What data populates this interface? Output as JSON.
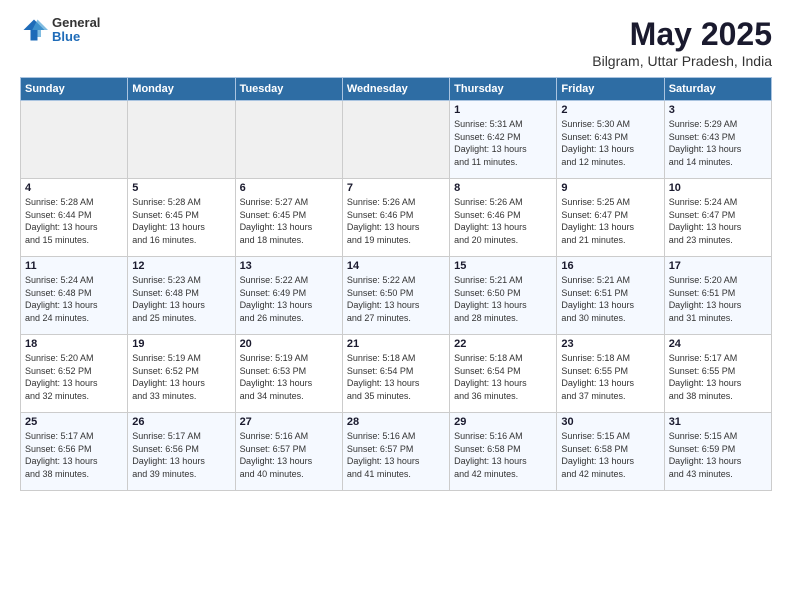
{
  "header": {
    "logo_general": "General",
    "logo_blue": "Blue",
    "title": "May 2025",
    "subtitle": "Bilgram, Uttar Pradesh, India"
  },
  "weekdays": [
    "Sunday",
    "Monday",
    "Tuesday",
    "Wednesday",
    "Thursday",
    "Friday",
    "Saturday"
  ],
  "weeks": [
    [
      {
        "day": "",
        "info": ""
      },
      {
        "day": "",
        "info": ""
      },
      {
        "day": "",
        "info": ""
      },
      {
        "day": "",
        "info": ""
      },
      {
        "day": "1",
        "info": "Sunrise: 5:31 AM\nSunset: 6:42 PM\nDaylight: 13 hours\nand 11 minutes."
      },
      {
        "day": "2",
        "info": "Sunrise: 5:30 AM\nSunset: 6:43 PM\nDaylight: 13 hours\nand 12 minutes."
      },
      {
        "day": "3",
        "info": "Sunrise: 5:29 AM\nSunset: 6:43 PM\nDaylight: 13 hours\nand 14 minutes."
      }
    ],
    [
      {
        "day": "4",
        "info": "Sunrise: 5:28 AM\nSunset: 6:44 PM\nDaylight: 13 hours\nand 15 minutes."
      },
      {
        "day": "5",
        "info": "Sunrise: 5:28 AM\nSunset: 6:45 PM\nDaylight: 13 hours\nand 16 minutes."
      },
      {
        "day": "6",
        "info": "Sunrise: 5:27 AM\nSunset: 6:45 PM\nDaylight: 13 hours\nand 18 minutes."
      },
      {
        "day": "7",
        "info": "Sunrise: 5:26 AM\nSunset: 6:46 PM\nDaylight: 13 hours\nand 19 minutes."
      },
      {
        "day": "8",
        "info": "Sunrise: 5:26 AM\nSunset: 6:46 PM\nDaylight: 13 hours\nand 20 minutes."
      },
      {
        "day": "9",
        "info": "Sunrise: 5:25 AM\nSunset: 6:47 PM\nDaylight: 13 hours\nand 21 minutes."
      },
      {
        "day": "10",
        "info": "Sunrise: 5:24 AM\nSunset: 6:47 PM\nDaylight: 13 hours\nand 23 minutes."
      }
    ],
    [
      {
        "day": "11",
        "info": "Sunrise: 5:24 AM\nSunset: 6:48 PM\nDaylight: 13 hours\nand 24 minutes."
      },
      {
        "day": "12",
        "info": "Sunrise: 5:23 AM\nSunset: 6:48 PM\nDaylight: 13 hours\nand 25 minutes."
      },
      {
        "day": "13",
        "info": "Sunrise: 5:22 AM\nSunset: 6:49 PM\nDaylight: 13 hours\nand 26 minutes."
      },
      {
        "day": "14",
        "info": "Sunrise: 5:22 AM\nSunset: 6:50 PM\nDaylight: 13 hours\nand 27 minutes."
      },
      {
        "day": "15",
        "info": "Sunrise: 5:21 AM\nSunset: 6:50 PM\nDaylight: 13 hours\nand 28 minutes."
      },
      {
        "day": "16",
        "info": "Sunrise: 5:21 AM\nSunset: 6:51 PM\nDaylight: 13 hours\nand 30 minutes."
      },
      {
        "day": "17",
        "info": "Sunrise: 5:20 AM\nSunset: 6:51 PM\nDaylight: 13 hours\nand 31 minutes."
      }
    ],
    [
      {
        "day": "18",
        "info": "Sunrise: 5:20 AM\nSunset: 6:52 PM\nDaylight: 13 hours\nand 32 minutes."
      },
      {
        "day": "19",
        "info": "Sunrise: 5:19 AM\nSunset: 6:52 PM\nDaylight: 13 hours\nand 33 minutes."
      },
      {
        "day": "20",
        "info": "Sunrise: 5:19 AM\nSunset: 6:53 PM\nDaylight: 13 hours\nand 34 minutes."
      },
      {
        "day": "21",
        "info": "Sunrise: 5:18 AM\nSunset: 6:54 PM\nDaylight: 13 hours\nand 35 minutes."
      },
      {
        "day": "22",
        "info": "Sunrise: 5:18 AM\nSunset: 6:54 PM\nDaylight: 13 hours\nand 36 minutes."
      },
      {
        "day": "23",
        "info": "Sunrise: 5:18 AM\nSunset: 6:55 PM\nDaylight: 13 hours\nand 37 minutes."
      },
      {
        "day": "24",
        "info": "Sunrise: 5:17 AM\nSunset: 6:55 PM\nDaylight: 13 hours\nand 38 minutes."
      }
    ],
    [
      {
        "day": "25",
        "info": "Sunrise: 5:17 AM\nSunset: 6:56 PM\nDaylight: 13 hours\nand 38 minutes."
      },
      {
        "day": "26",
        "info": "Sunrise: 5:17 AM\nSunset: 6:56 PM\nDaylight: 13 hours\nand 39 minutes."
      },
      {
        "day": "27",
        "info": "Sunrise: 5:16 AM\nSunset: 6:57 PM\nDaylight: 13 hours\nand 40 minutes."
      },
      {
        "day": "28",
        "info": "Sunrise: 5:16 AM\nSunset: 6:57 PM\nDaylight: 13 hours\nand 41 minutes."
      },
      {
        "day": "29",
        "info": "Sunrise: 5:16 AM\nSunset: 6:58 PM\nDaylight: 13 hours\nand 42 minutes."
      },
      {
        "day": "30",
        "info": "Sunrise: 5:15 AM\nSunset: 6:58 PM\nDaylight: 13 hours\nand 42 minutes."
      },
      {
        "day": "31",
        "info": "Sunrise: 5:15 AM\nSunset: 6:59 PM\nDaylight: 13 hours\nand 43 minutes."
      }
    ]
  ]
}
